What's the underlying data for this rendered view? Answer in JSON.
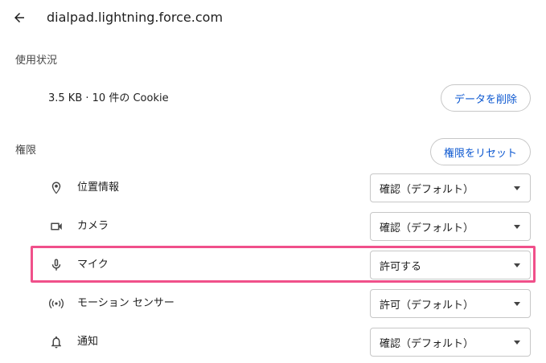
{
  "header": {
    "back_icon": "arrow-left-icon",
    "site": "dialpad.lightning.force.com"
  },
  "usage": {
    "section_title": "使用状況",
    "summary": "3.5 KB · 10 件の Cookie",
    "delete_button": "データを削除"
  },
  "permissions": {
    "section_title": "権限",
    "reset_button": "権限をリセット",
    "items": [
      {
        "icon": "location-pin-icon",
        "label": "位置情報",
        "value": "確認（デフォルト）"
      },
      {
        "icon": "camera-icon",
        "label": "カメラ",
        "value": "確認（デフォルト）"
      },
      {
        "icon": "microphone-icon",
        "label": "マイク",
        "value": "許可する"
      },
      {
        "icon": "motion-sensor-icon",
        "label": "モーション センサー",
        "value": "許可（デフォルト）"
      },
      {
        "icon": "bell-icon",
        "label": "通知",
        "value": "確認（デフォルト）"
      }
    ]
  },
  "colors": {
    "accent": "#0b57d0",
    "highlight_border": "#f0508a"
  }
}
